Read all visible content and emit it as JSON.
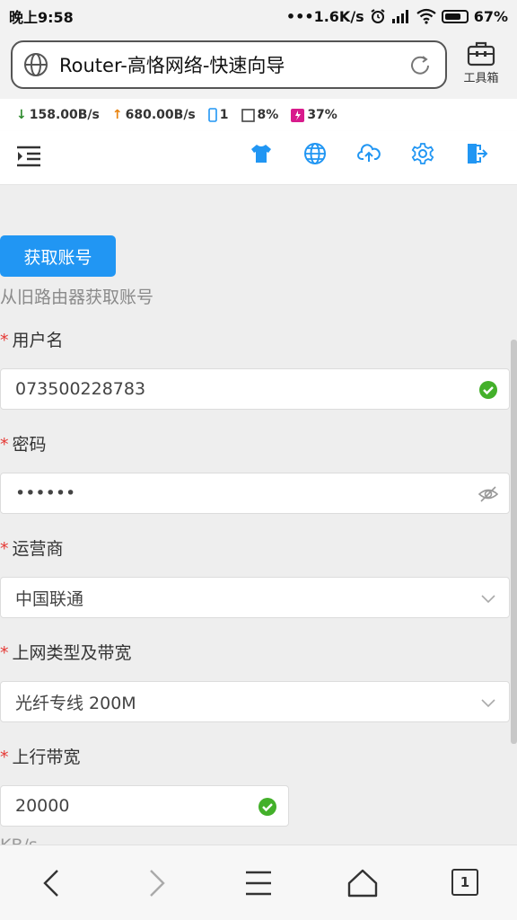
{
  "status_bar": {
    "time": "晚上9:58",
    "net_speed": "•••1.6K/s",
    "battery": "67%"
  },
  "browser": {
    "title": "Router-高恪网络-快速向导",
    "toolbox_label": "工具箱",
    "tab_count": "1"
  },
  "router_info": {
    "download": "158.00B/s",
    "upload": "680.00B/s",
    "devices": "1",
    "memory": "8%",
    "cpu": "37%"
  },
  "nav_icons": [
    "menu-icon",
    "shirt-icon",
    "globe-icon",
    "cloud-upload-icon",
    "gear-icon",
    "logout-icon"
  ],
  "form": {
    "fetch_button": "获取账号",
    "fetch_help": "从旧路由器获取账号",
    "required_mark": "*",
    "username_label": "用户名",
    "username_value": "073500228783",
    "password_label": "密码",
    "password_value": "••••••",
    "isp_label": "运营商",
    "isp_value": "中国联通",
    "type_label": "上网类型及带宽",
    "type_value": "光纤专线 200M",
    "upstream_label": "上行带宽",
    "upstream_value": "20000",
    "upstream_unit": "KB/s"
  },
  "colors": {
    "primary": "#2196f3",
    "success": "#43b02a",
    "required": "#e53935"
  }
}
